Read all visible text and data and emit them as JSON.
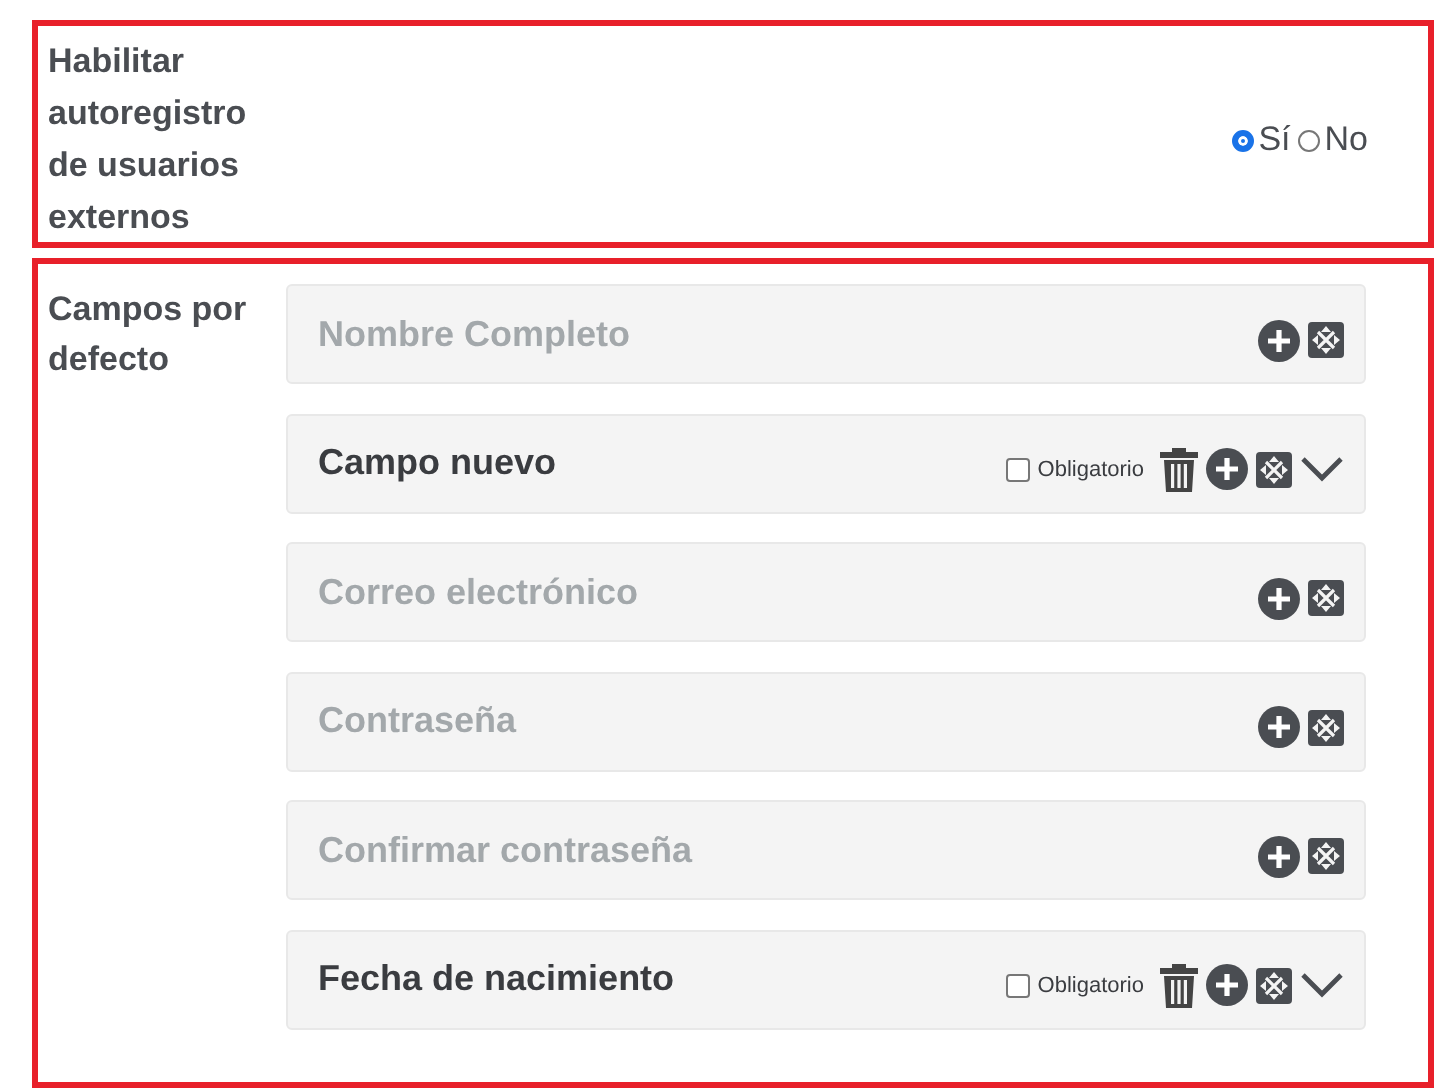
{
  "self_registration": {
    "label": "Habilitar autoregistro de usuarios externos",
    "options": [
      {
        "label": "Sí",
        "selected": true
      },
      {
        "label": "No",
        "selected": false
      }
    ]
  },
  "default_fields": {
    "label": "Campos por defecto",
    "fields": [
      {
        "kind": "fixed",
        "name": "Nombre Completo"
      },
      {
        "kind": "custom",
        "name": "Campo nuevo",
        "required_label": "Obligatorio",
        "required": false
      },
      {
        "kind": "fixed",
        "name": "Correo electrónico"
      },
      {
        "kind": "fixed",
        "name": "Contraseña"
      },
      {
        "kind": "fixed",
        "name": "Confirmar contraseña"
      },
      {
        "kind": "custom",
        "name": "Fecha de nacimiento",
        "required_label": "Obligatorio",
        "required": false
      }
    ]
  }
}
